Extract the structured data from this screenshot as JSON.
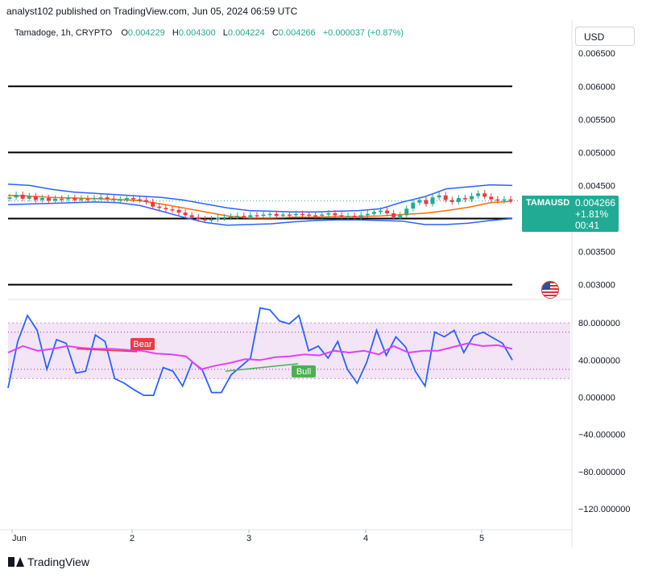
{
  "header": {
    "published": "analyst102 published on TradingView.com, Jun 05, 2024 06:59 UTC"
  },
  "ohlc": {
    "symbol": "Tamadoge, 1h, CRYPTO",
    "o_label": "O",
    "o_value": "0.004229",
    "h_label": "H",
    "h_value": "0.004300",
    "l_label": "L",
    "l_value": "0.004224",
    "c_label": "C",
    "c_value": "0.004266",
    "change": "+0.000037 (+0.87%)"
  },
  "currency_button": "USD",
  "price_tag": {
    "symbol": "TAMAUSD",
    "price": "0.004266",
    "change_pct": "+1.81%",
    "countdown": "00:41"
  },
  "footer": {
    "brand": "TradingView"
  },
  "colors": {
    "up": "#22ab94",
    "down": "#f23645",
    "band": "#2962ff",
    "basis": "#ff6d00",
    "stoch_k": "#2962ff",
    "stoch_d": "#e040fb",
    "stoch_zone": "#f3e5f5",
    "hline": "#000000"
  },
  "chart_data": [
    {
      "type": "candlestick",
      "title": "Tamadoge, 1h, CRYPTO",
      "ylim": [
        0.0028,
        0.0066
      ],
      "y_ticks": [
        "0.006500",
        "0.006000",
        "0.005500",
        "0.005000",
        "0.004500",
        "0.003500",
        "0.003000"
      ],
      "x_ticks": [
        "Jun",
        "2",
        "3",
        "4",
        "5"
      ],
      "horizontal_levels": [
        0.006,
        0.005,
        0.004,
        0.003
      ],
      "close_series": [
        0.00432,
        0.00436,
        0.0043,
        0.00434,
        0.00428,
        0.00431,
        0.00427,
        0.0043,
        0.00429,
        0.00431,
        0.00428,
        0.0043,
        0.00429,
        0.00431,
        0.00432,
        0.0043,
        0.00428,
        0.00429,
        0.00431,
        0.00429,
        0.00428,
        0.00425,
        0.00418,
        0.00416,
        0.00414,
        0.00413,
        0.00409,
        0.00405,
        0.00402,
        0.00399,
        0.00398,
        0.00399,
        0.00401,
        0.00402,
        0.00403,
        0.00404,
        0.00402,
        0.00405,
        0.00404,
        0.00406,
        0.00407,
        0.00404,
        0.00406,
        0.00405,
        0.00407,
        0.00406,
        0.00405,
        0.00404,
        0.00406,
        0.00408,
        0.00405,
        0.00403,
        0.00404,
        0.00402,
        0.00405,
        0.00407,
        0.0041,
        0.00412,
        0.00408,
        0.00402,
        0.00405,
        0.00415,
        0.00424,
        0.00428,
        0.00422,
        0.00432,
        0.00435,
        0.00428,
        0.00425,
        0.00431,
        0.00429,
        0.00434,
        0.00438,
        0.00433,
        0.00429,
        0.00427,
        0.00429,
        0.00427
      ],
      "upper_band": [
        0.00452,
        0.0045,
        0.00444,
        0.0044,
        0.00438,
        0.00436,
        0.00434,
        0.00432,
        0.00428,
        0.00422,
        0.00416,
        0.00412,
        0.00411,
        0.0041,
        0.0041,
        0.00411,
        0.00412,
        0.00415,
        0.00425,
        0.00433,
        0.00445,
        0.00448,
        0.00451,
        0.0045
      ],
      "middle_band": [
        0.00435,
        0.00434,
        0.00432,
        0.00431,
        0.0043,
        0.00429,
        0.00427,
        0.00422,
        0.00416,
        0.0041,
        0.00404,
        0.00401,
        0.00401,
        0.00402,
        0.00402,
        0.00403,
        0.00403,
        0.00404,
        0.00406,
        0.00408,
        0.00412,
        0.00417,
        0.00424,
        0.00426
      ],
      "lower_band": [
        0.00421,
        0.00422,
        0.00423,
        0.00424,
        0.00425,
        0.00424,
        0.0042,
        0.00411,
        0.00402,
        0.00394,
        0.0039,
        0.00391,
        0.00392,
        0.00395,
        0.00397,
        0.00398,
        0.00398,
        0.00397,
        0.00396,
        0.00391,
        0.00391,
        0.00393,
        0.00397,
        0.004
      ],
      "last_price": "0.004266"
    },
    {
      "type": "line",
      "ylim": [
        -140,
        100
      ],
      "y_ticks": [
        "80.000000",
        "40.000000",
        "0.000000",
        "−40.000000",
        "−80.000000",
        "−120.000000"
      ],
      "band": [
        20,
        80
      ],
      "overbought_oversold": [
        70,
        30
      ],
      "k_line": [
        10,
        60,
        88,
        72,
        30,
        62,
        58,
        26,
        28,
        67,
        60,
        20,
        15,
        8,
        2,
        2,
        32,
        28,
        12,
        38,
        30,
        5,
        5,
        24,
        33,
        42,
        96,
        94,
        82,
        79,
        88,
        50,
        55,
        42,
        60,
        30,
        15,
        38,
        72,
        45,
        65,
        54,
        28,
        12,
        70,
        65,
        72,
        48,
        66,
        70,
        64,
        58,
        40
      ],
      "d_line": [
        48,
        55,
        50,
        52,
        55,
        53,
        52,
        52,
        51,
        50,
        47,
        46,
        44,
        30,
        34,
        37,
        41,
        40,
        43,
        44,
        46,
        45,
        50,
        48,
        50,
        46,
        55,
        48,
        50,
        50,
        54,
        58,
        55,
        56,
        52
      ],
      "annotations": [
        {
          "label": "Bear",
          "start": [
            0.0,
            52
          ],
          "end": [
            0.45,
            49
          ]
        },
        {
          "label": "Bull",
          "start": [
            0.0,
            28
          ],
          "end": [
            0.3,
            36
          ]
        }
      ]
    }
  ]
}
